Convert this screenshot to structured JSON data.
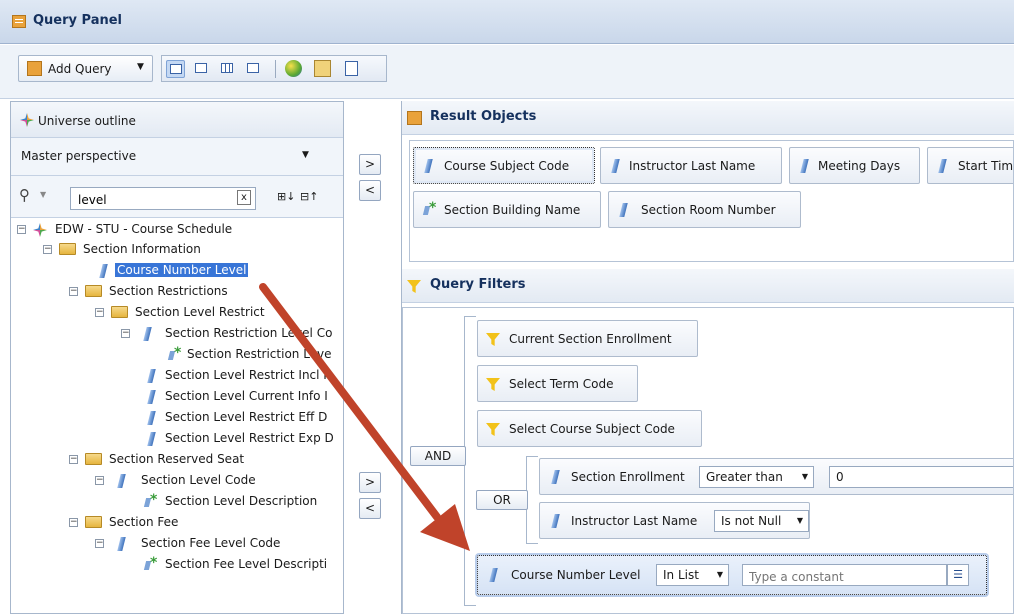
{
  "window": {
    "title": "Query Panel"
  },
  "toolbar": {
    "add_query_label": "Add Query"
  },
  "universe": {
    "header": "Universe outline",
    "perspective": "Master perspective",
    "search_value": "level",
    "clear_label": "x"
  },
  "tree": {
    "root": "EDW - STU - Course Schedule",
    "section_information": "Section Information",
    "course_number_level": "Course Number Level",
    "section_restrictions": "Section Restrictions",
    "section_level_restrict": "Section Level Restrict",
    "section_restriction_level_co": "Section Restriction Level Co",
    "section_restriction_leve": "Section Restriction Leve",
    "section_level_restrict_incl": "Section Level Restrict Incl I",
    "section_level_current_info": "Section Level Current Info I",
    "section_level_restrict_eff": "Section Level Restrict Eff D",
    "section_level_restrict_exp": "Section Level Restrict Exp D",
    "section_reserved_seat": "Section Reserved Seat",
    "section_level_code": "Section Level Code",
    "section_level_description": "Section Level Description",
    "section_fee": "Section Fee",
    "section_fee_level_code": "Section Fee Level Code",
    "section_fee_level_description": "Section Fee Level Descripti"
  },
  "arrows": {
    "add": ">",
    "remove": "<"
  },
  "result_objects": {
    "header": "Result Objects",
    "items": [
      "Course Subject Code",
      "Instructor Last Name",
      "Meeting Days",
      "Start Tim",
      "Section Building Name",
      "Section Room Number"
    ]
  },
  "query_filters": {
    "header": "Query Filters",
    "and_label": "AND",
    "or_label": "OR",
    "predefined": [
      "Current Section Enrollment",
      "Select Term Code",
      "Select Course Subject Code"
    ],
    "section_enrollment": {
      "object": "Section Enrollment",
      "operator": "Greater than",
      "value": "0"
    },
    "instructor_last_name": {
      "object": "Instructor Last Name",
      "operator": "Is not Null"
    },
    "course_number_level": {
      "object": "Course Number Level",
      "operator": "In List",
      "placeholder": "Type a constant"
    }
  },
  "colors": {
    "selection": "#3875d7",
    "arrow": "#c0432a",
    "header_text": "#15315e"
  }
}
